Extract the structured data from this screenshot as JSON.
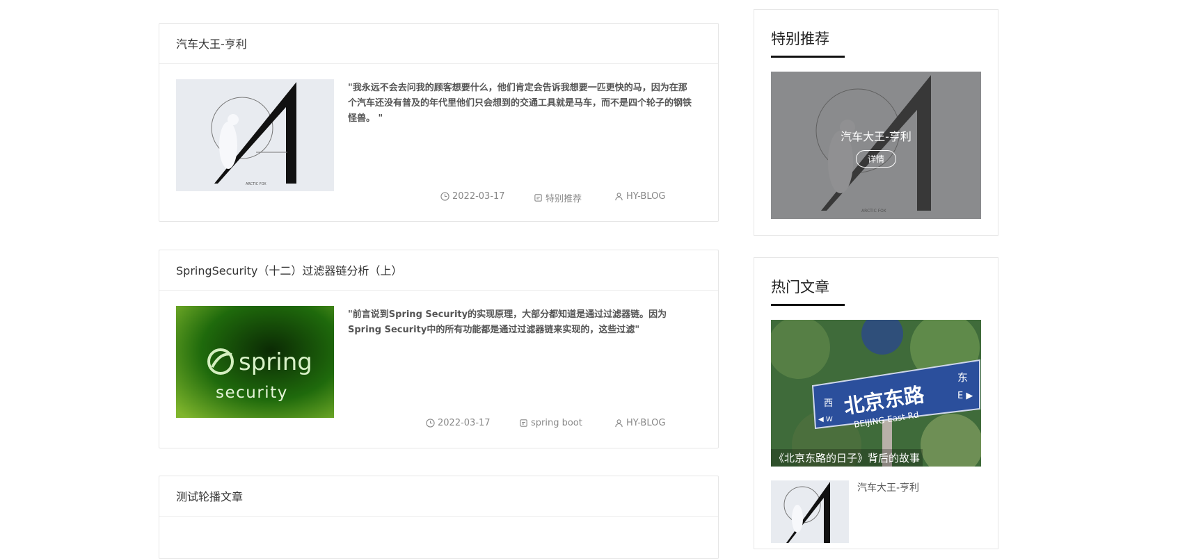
{
  "posts": [
    {
      "title": "汽车大王-亨利",
      "excerpt": "\"我永远不会去问我的顾客想要什么，他们肯定会告诉我想要一匹更快的马，因为在那个汽车还没有普及的年代里他们只会想到的交通工具就是马车，而不是四个轮子的钢铁怪兽。 \"",
      "date": "2022-03-17",
      "category": "特别推荐",
      "author": "HY-BLOG",
      "image": "arctic-fox-art"
    },
    {
      "title": "SpringSecurity（十二）过滤器链分析（上）",
      "excerpt": "\"前言说到Spring Security的实现原理，大部分都知道是通过过滤器链。因为Spring Security中的所有功能都是通过过滤器链来实现的，这些过滤\"",
      "date": "2022-03-17",
      "category": "spring boot",
      "author": "HY-BLOG",
      "image": "spring-security-logo",
      "logo_word": "spring",
      "logo_sub": "security"
    },
    {
      "title": "测试轮播文章"
    }
  ],
  "sidebar": {
    "special": {
      "heading": "特别推荐",
      "item_title": "汽车大王-亨利",
      "detail_label": "详情"
    },
    "hot": {
      "heading": "热门文章",
      "featured_caption": "《北京东路的日子》背后的故事",
      "sign_main": "北京东路",
      "sign_sub": "BEIJING East Rd",
      "sign_west": "西",
      "sign_east": "东",
      "sign_w": "◀ W",
      "sign_e": "E ▶",
      "item_title": "汽车大王-亨利"
    },
    "art_text": "ARCTIC FOX"
  },
  "colors": {
    "border": "#e6e6e6",
    "meta": "#888888",
    "overlay": "rgba(80,80,80,0.6)"
  }
}
